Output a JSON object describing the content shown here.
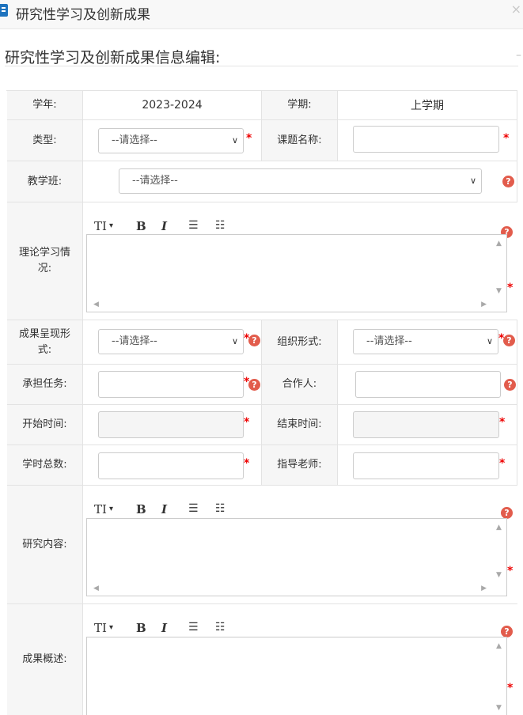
{
  "window": {
    "title": "研究性学习及创新成果",
    "close_glyph": "×"
  },
  "section": {
    "title": "研究性学习及创新成果信息编辑:",
    "dash": "–"
  },
  "form": {
    "school_year": {
      "label": "学年:",
      "value": "2023-2024"
    },
    "semester": {
      "label": "学期:",
      "value": "上学期"
    },
    "type": {
      "label": "类型:",
      "selected": "--请选择--"
    },
    "topic_name": {
      "label": "课题名称:",
      "value": ""
    },
    "teaching_class": {
      "label": "教学班:",
      "selected": "--请选择--"
    },
    "theory_study": {
      "label": "理论学习情况:"
    },
    "result_form": {
      "label": "成果呈现形式:",
      "selected": "--请选择--"
    },
    "org_form": {
      "label": "组织形式:",
      "selected": "--请选择--"
    },
    "task": {
      "label": "承担任务:",
      "value": ""
    },
    "partner": {
      "label": "合作人:",
      "value": ""
    },
    "start_time": {
      "label": "开始时间:",
      "value": ""
    },
    "end_time": {
      "label": "结束时间:",
      "value": ""
    },
    "total_hours": {
      "label": "学时总数:",
      "value": ""
    },
    "advisor": {
      "label": "指导老师:",
      "value": ""
    },
    "research_content": {
      "label": "研究内容:"
    },
    "result_summary": {
      "label": "成果概述:"
    }
  },
  "toolbar": {
    "font_size": "TI",
    "font_caret": "▾",
    "bold": "B",
    "italic": "I",
    "bullet_list": "☰",
    "numbered_list": "☷"
  },
  "glyphs": {
    "required": "*",
    "help": "?",
    "chevron": "∨",
    "up": "▲",
    "down": "▼",
    "left": "◀",
    "right": "▶"
  },
  "icons": {
    "window_icon": "document-icon",
    "help_icon": "question-circle-icon",
    "select_arrow": "chevron-down-icon"
  },
  "colors": {
    "required": "#ee0000",
    "help": "#e25c4c",
    "label_bg": "#f6f6f6",
    "border": "#e3e3e3"
  }
}
